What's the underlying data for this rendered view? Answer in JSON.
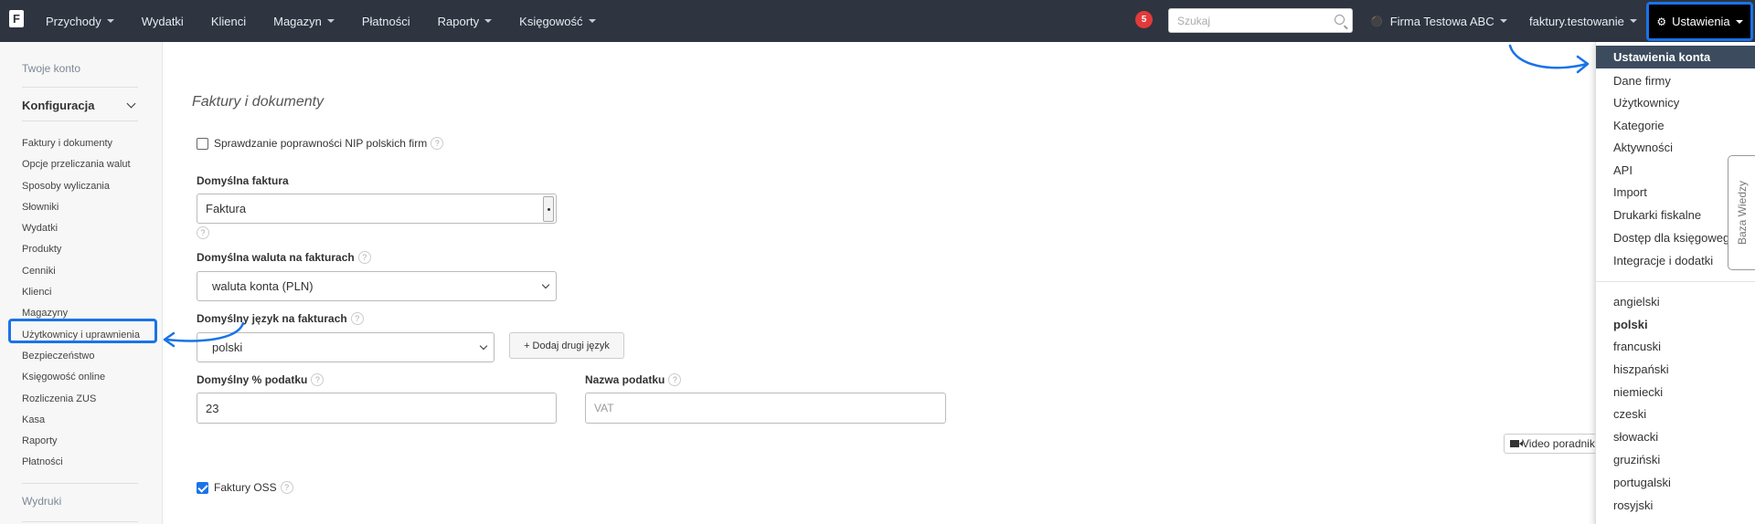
{
  "topbar": {
    "logo": "F",
    "nav": [
      {
        "label": "Przychody",
        "dropdown": true
      },
      {
        "label": "Wydatki",
        "dropdown": false
      },
      {
        "label": "Klienci",
        "dropdown": false
      },
      {
        "label": "Magazyn",
        "dropdown": true
      },
      {
        "label": "Płatności",
        "dropdown": false
      },
      {
        "label": "Raporty",
        "dropdown": true
      },
      {
        "label": "Księgowość",
        "dropdown": true
      }
    ],
    "notification_count": "5",
    "search_placeholder": "Szukaj",
    "company": "Firma Testowa ABC",
    "account": "faktury.testowanie",
    "settings": "Ustawienia"
  },
  "sidebar": {
    "account": "Twoje konto",
    "configuration": "Konfiguracja",
    "items": [
      "Faktury i dokumenty",
      "Opcje przeliczania walut",
      "Sposoby wyliczania",
      "Słowniki",
      "Wydatki",
      "Produkty",
      "Cenniki",
      "Klienci",
      "Magazyny",
      "Użytkownicy i uprawnienia",
      "Bezpieczeństwo",
      "Księgowość online",
      "Rozliczenia ZUS",
      "Kasa",
      "Raporty",
      "Płatności"
    ],
    "prints": "Wydruki"
  },
  "main": {
    "title": "Faktury i dokumenty",
    "nip_check": "Sprawdzanie poprawności NIP polskich firm",
    "default_invoice_label": "Domyślna faktura",
    "default_invoice_value": "Faktura",
    "currency_label": "Domyślna waluta na fakturach",
    "currency_value": "waluta konta (PLN)",
    "language_label": "Domyślny język na fakturach",
    "language_value": "polski",
    "add_language": "+ Dodaj drugi język",
    "tax_label": "Domyślny % podatku",
    "tax_value": "23",
    "tax_name_label": "Nazwa podatku",
    "tax_name_placeholder": "VAT",
    "oss": "Faktury OSS",
    "video": "Video poradnik",
    "help": "?"
  },
  "dropdown": {
    "active": "Ustawienia konta",
    "items": [
      "Dane firmy",
      "Użytkownicy",
      "Kategorie",
      "Aktywności",
      "API",
      "Import",
      "Drukarki fiskalne",
      "Dostęp dla księgowego",
      "Integracje i dodatki"
    ],
    "languages": [
      "angielski",
      "polski",
      "francuski",
      "hiszpański",
      "niemiecki",
      "czeski",
      "słowacki",
      "gruziński",
      "portugalski",
      "rosyjski"
    ],
    "selected_language": "polski"
  },
  "knowledge_base": "Baza Wiedzy",
  "colors": {
    "topbar": "#2e3440",
    "highlight": "#1a73e8",
    "menu_active": "#3c4b5e",
    "badge": "#e23a3a"
  }
}
